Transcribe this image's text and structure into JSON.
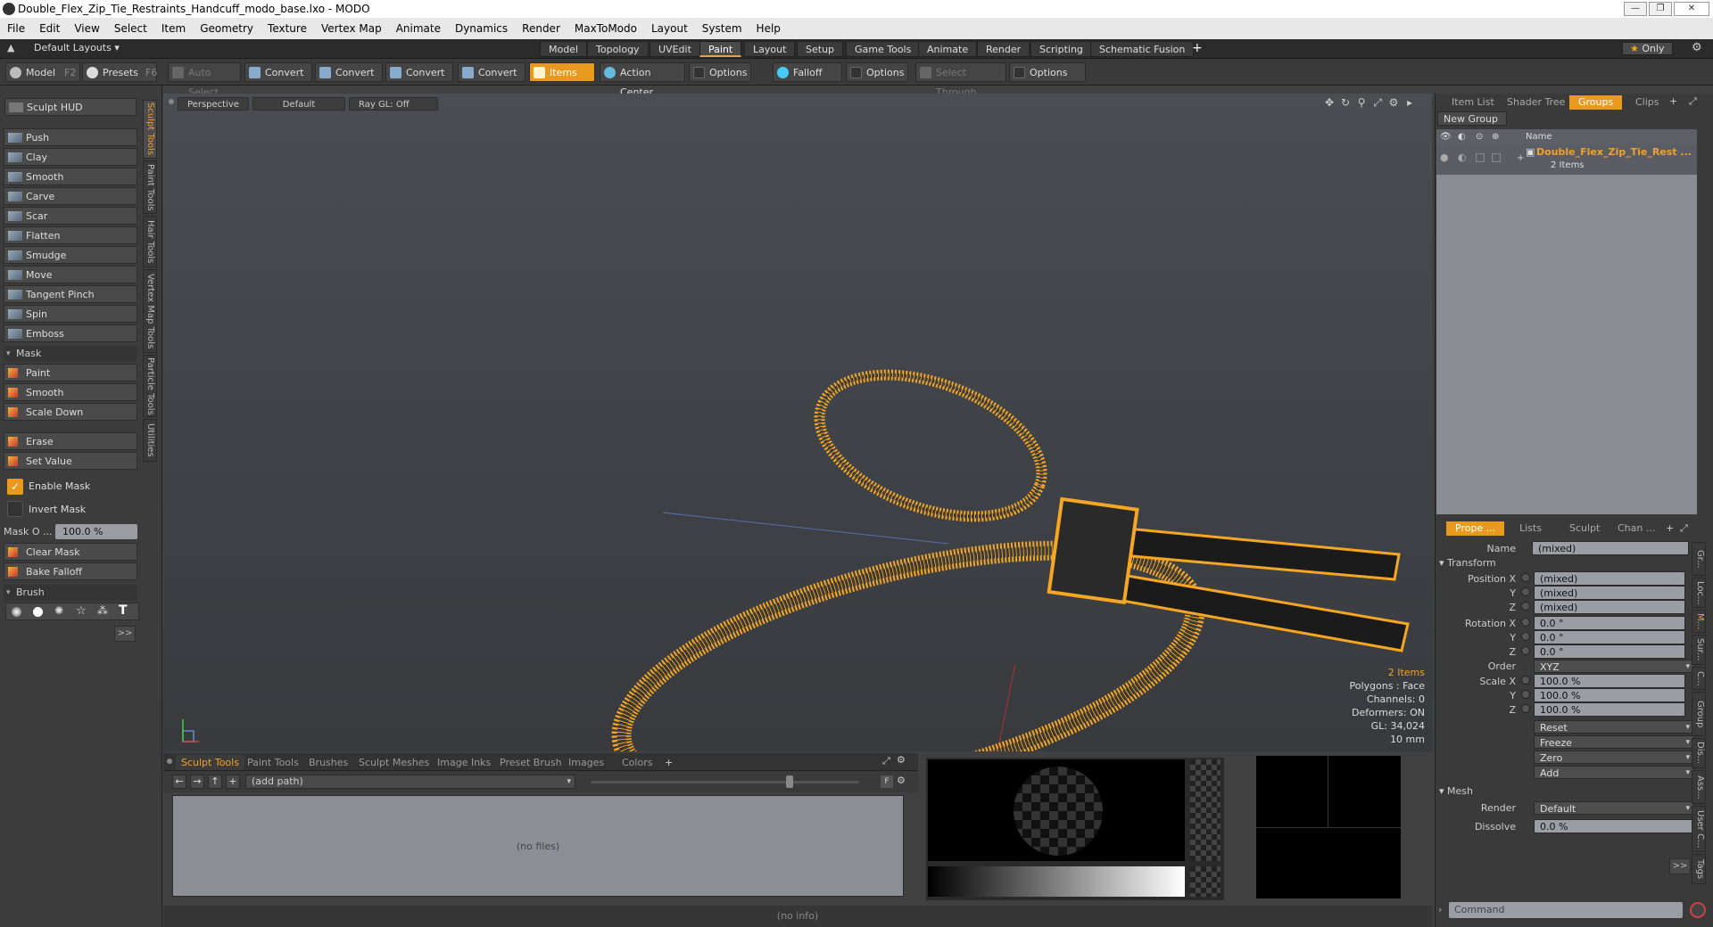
{
  "window": {
    "title": "Double_Flex_Zip_Tie_Restraints_Handcuff_modo_base.lxo - MODO"
  },
  "menu": [
    "File",
    "Edit",
    "View",
    "Select",
    "Item",
    "Geometry",
    "Texture",
    "Vertex Map",
    "Animate",
    "Dynamics",
    "Render",
    "MaxToModo",
    "Layout",
    "System",
    "Help"
  ],
  "layoutbar": {
    "layout_selector": "Default Layouts",
    "tabs": [
      "Model",
      "Topology",
      "UVEdit",
      "Paint",
      "Layout",
      "Setup",
      "Game Tools",
      "Animate",
      "Render",
      "Scripting",
      "Schematic Fusion"
    ],
    "active_tab": "Paint",
    "add": "+",
    "only": "Only"
  },
  "toolbar": {
    "model": "Model",
    "model_key": "F2",
    "presets": "Presets",
    "presets_key": "F6",
    "auto_select": "Auto Select",
    "convert1": "Convert",
    "convert2": "Convert",
    "convert3": "Convert",
    "convert4": "Convert",
    "items": "Items",
    "action_center": "Action Center",
    "options1": "Options",
    "falloff": "Falloff",
    "options2": "Options",
    "select_through": "Select Through",
    "options3": "Options"
  },
  "leftpanel": {
    "sculpt_hud": "Sculpt HUD",
    "tools": [
      "Push",
      "Clay",
      "Smooth",
      "Carve",
      "Scar",
      "Flatten",
      "Smudge",
      "Move",
      "Tangent Pinch",
      "Spin",
      "Emboss"
    ],
    "mask_section": "Mask",
    "mask_tools": [
      "Paint",
      "Smooth",
      "Scale Down"
    ],
    "erase": "Erase",
    "set_value": "Set Value",
    "enable_mask": "Enable Mask",
    "invert_mask": "Invert Mask",
    "mask_opacity_label": "Mask O ...",
    "mask_opacity_value": "100.0 %",
    "clear_mask": "Clear Mask",
    "bake_falloff": "Bake Falloff",
    "brush_section": "Brush",
    "more": ">>",
    "vtabs": [
      "Sculpt Tools",
      "Paint Tools",
      "Hair Tools",
      "Vertex Map Tools",
      "Particle Tools",
      "Utilities"
    ]
  },
  "viewport": {
    "view": "Perspective",
    "shading": "Default",
    "raygl": "Ray GL: Off",
    "stats": {
      "items": "2 Items",
      "polygons": "Polygons : Face",
      "channels": "Channels: 0",
      "deformers": "Deformers: ON",
      "gl": "GL: 34,024",
      "scale": "10 mm"
    },
    "colors": {
      "wire": "#f5a623",
      "dark": "#1b1b1b"
    }
  },
  "bottom": {
    "tabs": [
      "Sculpt Tools",
      "Paint Tools",
      "Brushes",
      "Sculpt Meshes",
      "Image Inks",
      "Preset Brush",
      "Images",
      "Colors"
    ],
    "active_tab": "Sculpt Tools",
    "add": "+",
    "path_placeholder": "(add path)",
    "no_files": "(no files)",
    "status": "(no info)"
  },
  "rightpanel": {
    "tabs": [
      "Item List",
      "Shader Tree",
      "Groups",
      "Clips"
    ],
    "active_tab": "Groups",
    "new_group": "New Group",
    "col_name": "Name",
    "group_name": "Double_Flex_Zip_Tie_Rest ...",
    "group_count": "2 Items",
    "prop_tabs": [
      "Prope ...",
      "Lists",
      "Sculpt",
      "Chan ..."
    ],
    "active_prop_tab": "Prope ...",
    "name_label": "Name",
    "name_value": "(mixed)",
    "transform_section": "Transform",
    "position_x_label": "Position X",
    "position_x": "(mixed)",
    "position_y_label": "Y",
    "position_y": "(mixed)",
    "position_z_label": "Z",
    "position_z": "(mixed)",
    "rotation_x_label": "Rotation X",
    "rotation_x": "0.0 °",
    "rotation_y_label": "Y",
    "rotation_y": "0.0 °",
    "rotation_z_label": "Z",
    "rotation_z": "0.0 °",
    "order_label": "Order",
    "order": "XYZ",
    "scale_x_label": "Scale X",
    "scale_x": "100.0 %",
    "scale_y_label": "Y",
    "scale_y": "100.0 %",
    "scale_z_label": "Z",
    "scale_z": "100.0 %",
    "reset": "Reset",
    "freeze": "Freeze",
    "zero": "Zero",
    "add": "Add",
    "mesh_section": "Mesh",
    "render_label": "Render",
    "render": "Default",
    "dissolve_label": "Dissolve",
    "dissolve": "0.0 %",
    "more": ">>",
    "command_placeholder": "Command",
    "vtabs": [
      "Gr...",
      "Loc...",
      "M...",
      "Sur...",
      "C...",
      "Group",
      "Dis...",
      "Ass...",
      "User C...",
      "Tags"
    ]
  }
}
